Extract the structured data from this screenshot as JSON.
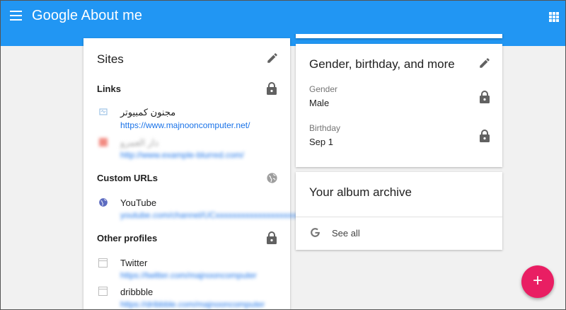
{
  "appbar": {
    "title": "Google About me",
    "menu_icon": "menu-icon",
    "apps_icon": "apps-grid-icon",
    "color": "#2196f3"
  },
  "sites": {
    "title": "Sites",
    "links": {
      "heading": "Links",
      "items": [
        {
          "name": "مجنون كمبيوتر",
          "url": "https://www.majnooncomputer.net/"
        },
        {
          "name": "دار العمرو",
          "url": "http://www.example-blurred.com/"
        }
      ]
    },
    "custom_urls": {
      "heading": "Custom URLs",
      "items": [
        {
          "name": "YouTube",
          "url": "youtube.com/channel/UCxxxxxxxxxxxxxxxxxxxxxx"
        }
      ]
    },
    "other_profiles": {
      "heading": "Other profiles",
      "items": [
        {
          "name": "Twitter",
          "url": "https://twitter.com/majnooncomputer"
        },
        {
          "name": "dribbble",
          "url": "https://dribbble.com/majnooncomputer"
        }
      ]
    }
  },
  "gender_card": {
    "title": "Gender, birthday, and more",
    "fields": [
      {
        "label": "Gender",
        "value": "Male"
      },
      {
        "label": "Birthday",
        "value": "Sep 1"
      }
    ]
  },
  "album_card": {
    "title": "Your album archive",
    "link": "See all"
  },
  "fab": {
    "label": "+",
    "color": "#e91e63"
  }
}
